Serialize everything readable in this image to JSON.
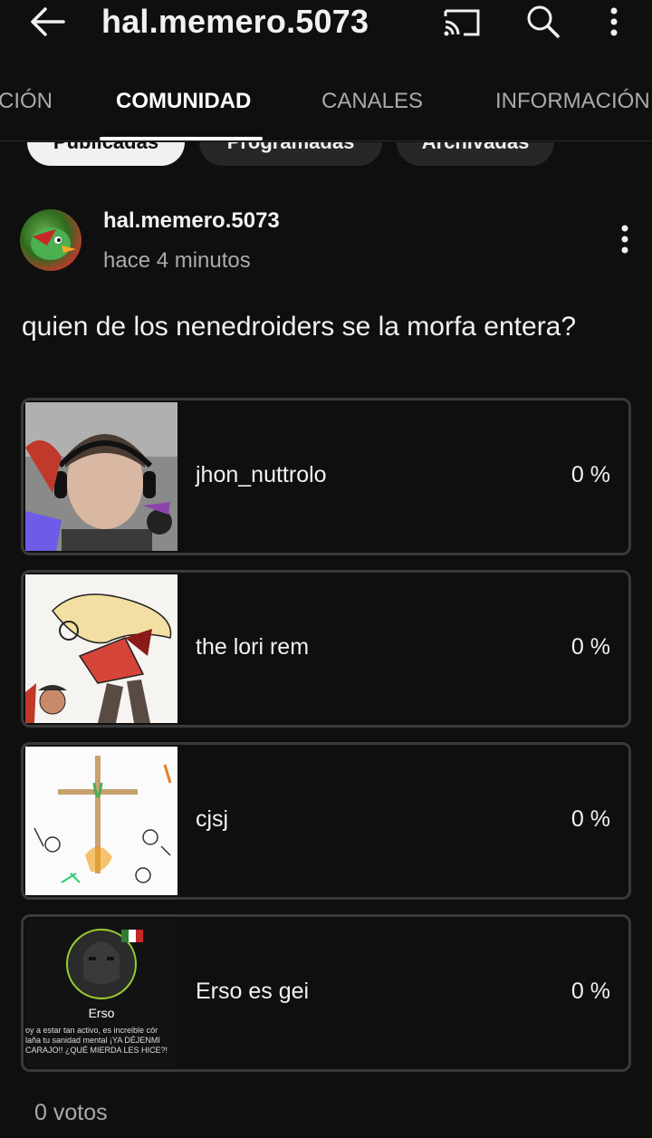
{
  "header": {
    "title": "hal.memero.5073",
    "icons": [
      "back-icon",
      "cast-icon",
      "search-icon",
      "more-vert-icon"
    ]
  },
  "tabs": [
    {
      "label": "CIÓN",
      "active": false
    },
    {
      "label": "COMUNIDAD",
      "active": true
    },
    {
      "label": "CANALES",
      "active": false
    },
    {
      "label": "INFORMACIÓN",
      "active": false
    }
  ],
  "chips": [
    {
      "label": "Publicadas",
      "selected": true
    },
    {
      "label": "Programadas",
      "selected": false
    },
    {
      "label": "Archivadas",
      "selected": false
    }
  ],
  "post": {
    "author": "hal.memero.5073",
    "time": "hace 4 minutos",
    "text": "quien de los nenedroiders se la morfa entera?"
  },
  "poll": {
    "options": [
      {
        "label": "jhon_nuttrolo",
        "percent": "0 %"
      },
      {
        "label": "the lori rem",
        "percent": "0 %"
      },
      {
        "label": "cjsj",
        "percent": "0 %"
      },
      {
        "label": "Erso es gei",
        "percent": "0 %"
      }
    ],
    "erso_image": {
      "name": "Erso",
      "line1": "oy a estar tan activo, es increible cór",
      "line2": "laña tu sanidad mental ¡YA DÉJENMI",
      "line3": "CARAJO!! ¿QUÉ MIERDA LES HICE?!"
    },
    "votes": "0 votos"
  },
  "colors": {
    "background": "#0f0f0f",
    "text_primary": "#f1f1f1",
    "text_secondary": "#aaaaaa",
    "option_border": "#3a3a3a"
  }
}
